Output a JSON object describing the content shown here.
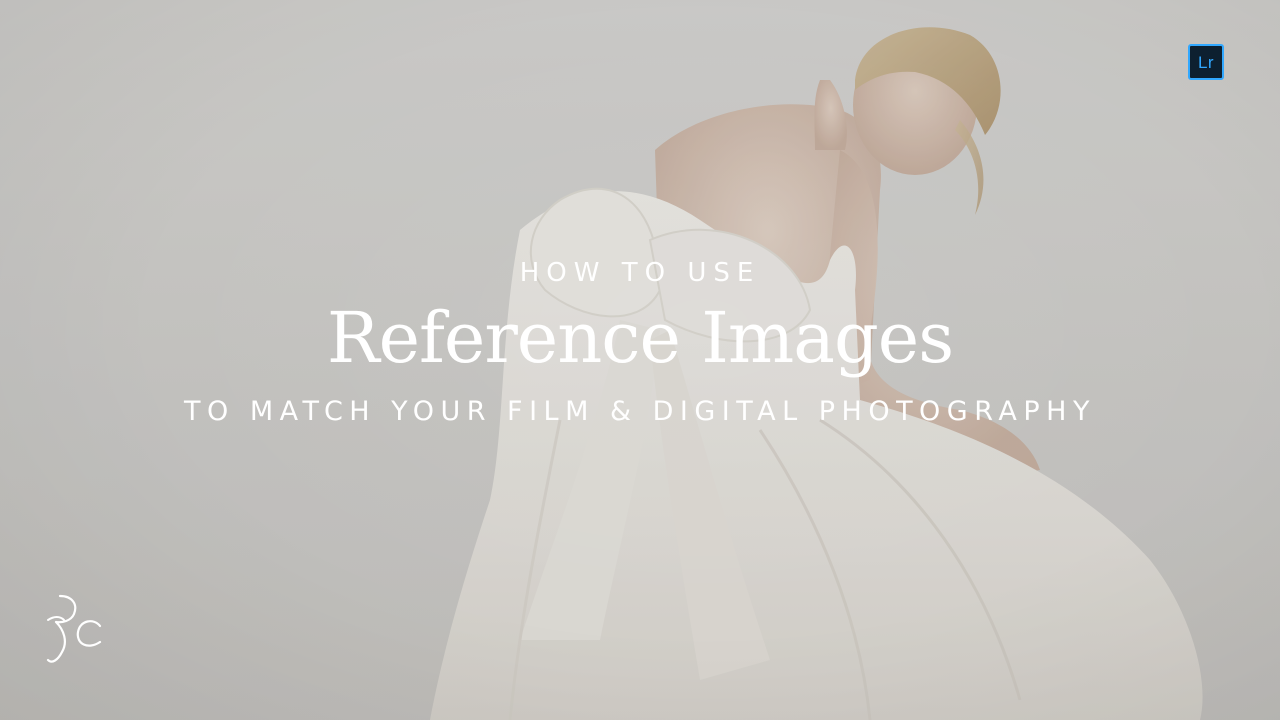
{
  "badge": {
    "label": "Lr",
    "accent": "#31a8ff",
    "background": "#0d2030"
  },
  "title": {
    "kicker": "HOW TO USE",
    "headline": "Reference Images",
    "subline": "TO MATCH YOUR FILM & DIGITAL PHOTOGRAPHY"
  },
  "logo": {
    "monogram": "RC",
    "icon": "rc-monogram-logo"
  },
  "colors": {
    "text": "#ffffff",
    "background": "#d6d5d1",
    "dress": "#f3f1ec"
  }
}
